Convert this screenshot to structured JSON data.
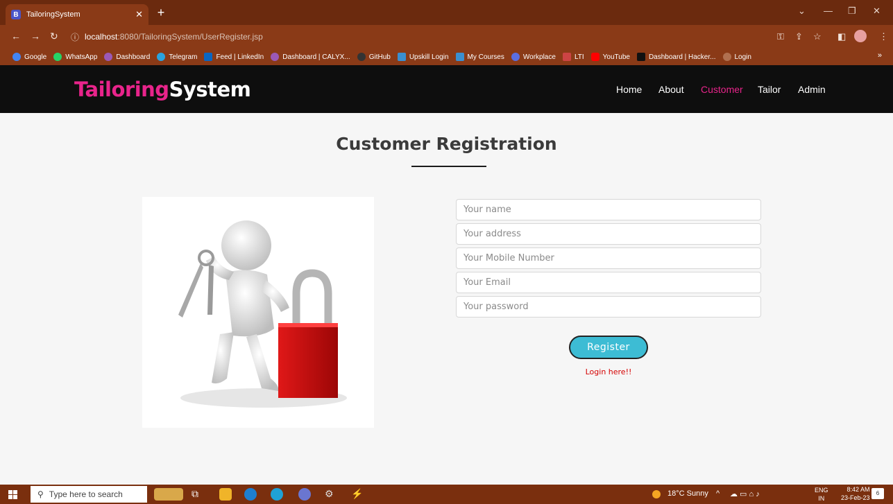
{
  "browser": {
    "tab_title": "TailoringSystem",
    "tab_icon_letter": "B",
    "url_host": "localhost",
    "url_rest": ":8080/TailoringSystem/UserRegister.jsp",
    "bookmarks": [
      "Google",
      "WhatsApp",
      "Dashboard",
      "Telegram",
      "Feed | LinkedIn",
      "Dashboard | CALYX...",
      "GitHub",
      "Upskill Login",
      "My Courses",
      "Workplace",
      "LTI",
      "YouTube",
      "Dashboard | Hacker...",
      "Login"
    ]
  },
  "site": {
    "logo_part1": "Tailoring",
    "logo_part2": "System",
    "nav": [
      "Home",
      "About",
      "Customer",
      "Tailor",
      "Admin"
    ],
    "active_nav": "Customer"
  },
  "form": {
    "title": "Customer Registration",
    "placeholders": {
      "name": "Your name",
      "address": "Your address",
      "mobile": "Your Mobile Number",
      "email": "Your Email",
      "password": "Your password"
    },
    "register_label": "Register",
    "login_link": "Login here!!"
  },
  "taskbar": {
    "search_placeholder": "Type here to search",
    "weather": "18°C  Sunny",
    "lang_line1": "ENG",
    "lang_line2": "IN",
    "time": "8:42 AM",
    "date": "23-Feb-23",
    "notification_count": "6"
  },
  "colors": {
    "brand_pink": "#e8248b",
    "button_teal": "#3dbcd4",
    "link_red": "#d40000",
    "header_black": "#0e0e0e",
    "chrome_brown": "#8a3a17"
  }
}
